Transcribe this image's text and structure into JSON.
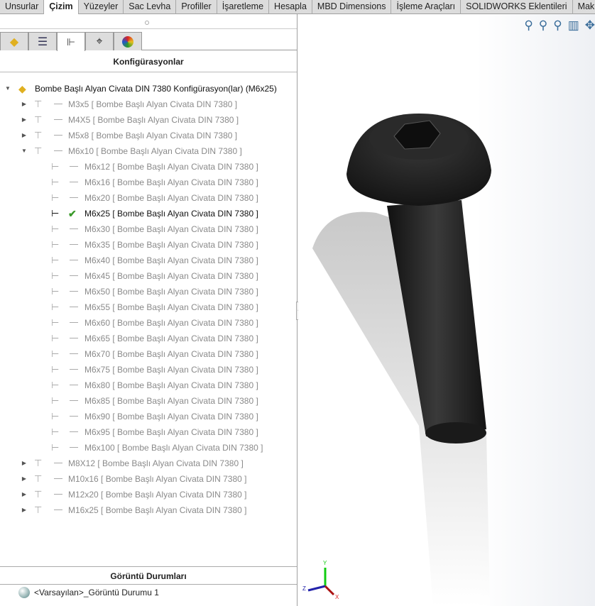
{
  "ribbon_tabs": [
    "Unsurlar",
    "Çizim",
    "Yüzeyler",
    "Sac Levha",
    "Profiller",
    "İşaretleme",
    "Hesapla",
    "MBD Dimensions",
    "İşleme Araçları",
    "SOLIDWORKS Eklentileri",
    "Makro"
  ],
  "active_tab": "Çizim",
  "panel_tabs": [
    "feature-manager",
    "property-manager",
    "configuration-manager",
    "dimxpert-manager",
    "display-manager"
  ],
  "panel_title": "Konfigürasyonlar",
  "tree": {
    "root": "Bombe Başlı Alyan Civata DIN 7380 Konfigürasyon(lar)  (M6x25)",
    "items": [
      {
        "label": "M3x5 [ Bombe Başlı Alyan Civata DIN 7380 ]",
        "level": 1,
        "expander": "collapsed"
      },
      {
        "label": "M4X5 [ Bombe Başlı Alyan Civata DIN 7380 ]",
        "level": 1,
        "expander": "collapsed"
      },
      {
        "label": "M5x8 [ Bombe Başlı Alyan Civata DIN 7380 ]",
        "level": 1,
        "expander": "collapsed"
      },
      {
        "label": "M6x10 [ Bombe Başlı Alyan Civata DIN 7380 ]",
        "level": 1,
        "expander": "expanded"
      },
      {
        "label": "M6x12 [ Bombe Başlı Alyan Civata DIN 7380 ]",
        "level": 2
      },
      {
        "label": "M6x16 [ Bombe Başlı Alyan Civata DIN 7380 ]",
        "level": 2
      },
      {
        "label": "M6x20 [ Bombe Başlı Alyan Civata DIN 7380 ]",
        "level": 2
      },
      {
        "label": "M6x25 [ Bombe Başlı Alyan Civata DIN 7380 ]",
        "level": 2,
        "active": true
      },
      {
        "label": "M6x30 [ Bombe Başlı Alyan Civata DIN 7380 ]",
        "level": 2
      },
      {
        "label": "M6x35 [ Bombe Başlı Alyan Civata DIN 7380 ]",
        "level": 2
      },
      {
        "label": "M6x40 [ Bombe Başlı Alyan Civata DIN 7380 ]",
        "level": 2
      },
      {
        "label": "M6x45 [ Bombe Başlı Alyan Civata DIN 7380 ]",
        "level": 2
      },
      {
        "label": "M6x50 [ Bombe Başlı Alyan Civata DIN 7380 ]",
        "level": 2
      },
      {
        "label": "M6x55 [ Bombe Başlı Alyan Civata DIN 7380 ]",
        "level": 2
      },
      {
        "label": "M6x60 [ Bombe Başlı Alyan Civata DIN 7380 ]",
        "level": 2
      },
      {
        "label": "M6x65 [ Bombe Başlı Alyan Civata DIN 7380 ]",
        "level": 2
      },
      {
        "label": "M6x70 [ Bombe Başlı Alyan Civata DIN 7380 ]",
        "level": 2
      },
      {
        "label": "M6x75 [ Bombe Başlı Alyan Civata DIN 7380 ]",
        "level": 2
      },
      {
        "label": "M6x80 [ Bombe Başlı Alyan Civata DIN 7380 ]",
        "level": 2
      },
      {
        "label": "M6x85 [ Bombe Başlı Alyan Civata DIN 7380 ]",
        "level": 2
      },
      {
        "label": "M6x90 [ Bombe Başlı Alyan Civata DIN 7380 ]",
        "level": 2
      },
      {
        "label": "M6x95 [ Bombe Başlı Alyan Civata DIN 7380 ]",
        "level": 2
      },
      {
        "label": "M6x100 [ Bombe Başlı Alyan Civata DIN 7380 ]",
        "level": 2
      },
      {
        "label": "M8X12 [ Bombe Başlı Alyan Civata DIN 7380 ]",
        "level": 1,
        "expander": "collapsed"
      },
      {
        "label": "M10x16 [ Bombe Başlı Alyan Civata DIN 7380 ]",
        "level": 1,
        "expander": "collapsed"
      },
      {
        "label": "M12x20 [ Bombe Başlı Alyan Civata DIN 7380 ]",
        "level": 1,
        "expander": "collapsed"
      },
      {
        "label": "M16x25 [ Bombe Başlı Alyan Civata DIN 7380 ]",
        "level": 1,
        "expander": "collapsed"
      }
    ]
  },
  "display_states": {
    "title": "Görüntü Durumları",
    "item": "<Varsayılan>_Görüntü Durumu 1"
  },
  "view_tools": [
    "zoom-to-fit-icon",
    "zoom-to-area-icon",
    "zoom-to-selection-icon",
    "section-view-icon",
    "pan-icon"
  ],
  "triad": {
    "x": "X",
    "y": "Y",
    "z": "Z"
  },
  "colors": {
    "check": "#3a9a2a",
    "inactive_text": "#8a8a8a",
    "active_text": "#111111"
  }
}
